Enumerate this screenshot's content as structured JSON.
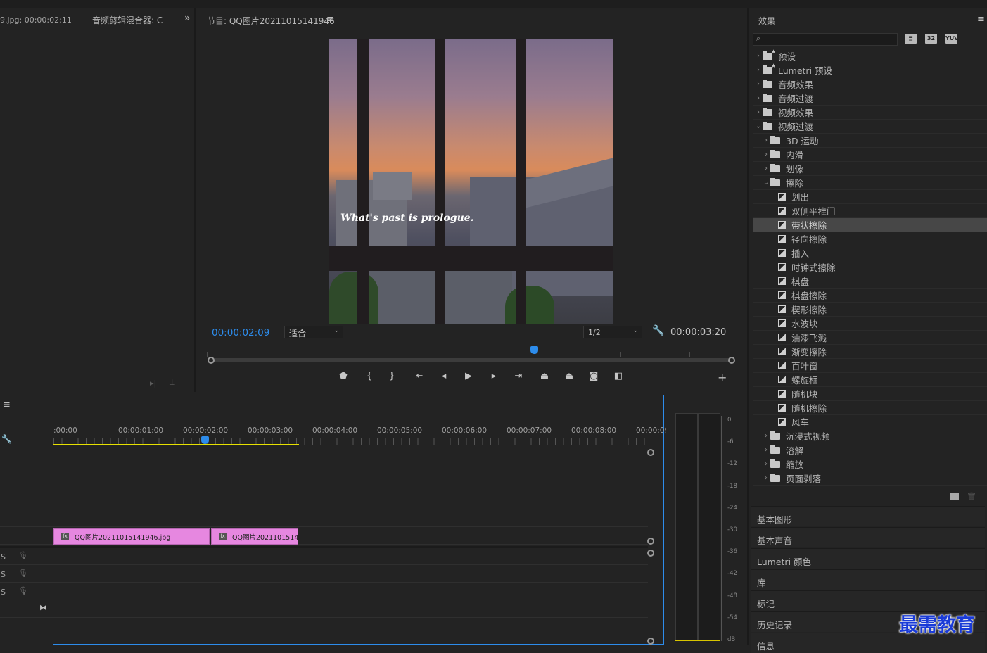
{
  "source_panel": {
    "tab_title": "9.jpg: 00:00:02:11",
    "mixer_tab": "音频剪辑混合器: C",
    "expand_icon": "double-chevron-right-icon"
  },
  "program": {
    "title": "节目: QQ图片20211015141946",
    "menu_icon": "hamburger-icon",
    "current_time": "00:00:02:09",
    "fit_label": "适合",
    "resolution_label": "1/2",
    "duration": "00:00:03:20",
    "image_text": "What's past is prologue.",
    "playhead_progress": 0.62,
    "accent": "#2d8ceb"
  },
  "controls": [
    {
      "name": "add-marker-button",
      "icon": "marker-icon",
      "glyph": "⬟"
    },
    {
      "name": "mark-in-button",
      "icon": "mark-in-icon",
      "glyph": "{"
    },
    {
      "name": "mark-out-button",
      "icon": "mark-out-icon",
      "glyph": "}"
    },
    {
      "name": "go-to-in-button",
      "icon": "go-to-in-icon",
      "glyph": "⇤"
    },
    {
      "name": "step-back-button",
      "icon": "step-back-icon",
      "glyph": "◂"
    },
    {
      "name": "play-button",
      "icon": "play-icon",
      "glyph": "▶"
    },
    {
      "name": "step-forward-button",
      "icon": "step-forward-icon",
      "glyph": "▸"
    },
    {
      "name": "go-to-out-button",
      "icon": "go-to-out-icon",
      "glyph": "⇥"
    },
    {
      "name": "lift-button",
      "icon": "lift-icon",
      "glyph": "⏏"
    },
    {
      "name": "extract-button",
      "icon": "extract-icon",
      "glyph": "⏏"
    },
    {
      "name": "export-frame-button",
      "icon": "camera-icon",
      "glyph": "◙"
    },
    {
      "name": "compare-view-button",
      "icon": "compare-icon",
      "glyph": "◧"
    }
  ],
  "effects": {
    "title": "效果",
    "menu_icon": "hamburger-icon",
    "search_placeholder": "",
    "toolbar_icons": [
      "accelerated-effects-icon",
      "32bit-icon",
      "yuv-icon"
    ],
    "toolbar_labels": [
      "≣",
      "32",
      "YUV"
    ],
    "tree": [
      {
        "label": "预设",
        "level": 0,
        "type": "folder-star",
        "open": false
      },
      {
        "label": "Lumetri 预设",
        "level": 0,
        "type": "folder-star",
        "open": false
      },
      {
        "label": "音频效果",
        "level": 0,
        "type": "folder",
        "open": false
      },
      {
        "label": "音频过渡",
        "level": 0,
        "type": "folder",
        "open": false
      },
      {
        "label": "视频效果",
        "level": 0,
        "type": "folder",
        "open": false
      },
      {
        "label": "视频过渡",
        "level": 0,
        "type": "folder",
        "open": true
      },
      {
        "label": "3D 运动",
        "level": 1,
        "type": "folder",
        "open": false
      },
      {
        "label": "内滑",
        "level": 1,
        "type": "folder",
        "open": false
      },
      {
        "label": "划像",
        "level": 1,
        "type": "folder",
        "open": false
      },
      {
        "label": "擦除",
        "level": 1,
        "type": "folder",
        "open": true
      },
      {
        "label": "划出",
        "level": 2,
        "type": "effect"
      },
      {
        "label": "双侧平推门",
        "level": 2,
        "type": "effect"
      },
      {
        "label": "带状擦除",
        "level": 2,
        "type": "effect",
        "selected": true
      },
      {
        "label": "径向擦除",
        "level": 2,
        "type": "effect"
      },
      {
        "label": "插入",
        "level": 2,
        "type": "effect"
      },
      {
        "label": "时钟式擦除",
        "level": 2,
        "type": "effect"
      },
      {
        "label": "棋盘",
        "level": 2,
        "type": "effect"
      },
      {
        "label": "棋盘擦除",
        "level": 2,
        "type": "effect"
      },
      {
        "label": "楔形擦除",
        "level": 2,
        "type": "effect"
      },
      {
        "label": "水波块",
        "level": 2,
        "type": "effect"
      },
      {
        "label": "油漆飞溅",
        "level": 2,
        "type": "effect"
      },
      {
        "label": "渐变擦除",
        "level": 2,
        "type": "effect"
      },
      {
        "label": "百叶窗",
        "level": 2,
        "type": "effect"
      },
      {
        "label": "螺旋框",
        "level": 2,
        "type": "effect"
      },
      {
        "label": "随机块",
        "level": 2,
        "type": "effect"
      },
      {
        "label": "随机擦除",
        "level": 2,
        "type": "effect"
      },
      {
        "label": "风车",
        "level": 2,
        "type": "effect"
      },
      {
        "label": "沉浸式视频",
        "level": 1,
        "type": "folder",
        "open": false
      },
      {
        "label": "溶解",
        "level": 1,
        "type": "folder",
        "open": false
      },
      {
        "label": "缩放",
        "level": 1,
        "type": "folder",
        "open": false
      },
      {
        "label": "页面剥落",
        "level": 1,
        "type": "folder",
        "open": false
      }
    ]
  },
  "side_sections": [
    "基本图形",
    "基本声音",
    "Lumetri 颜色",
    "库",
    "标记",
    "历史记录",
    "信息"
  ],
  "watermark": "最需教育",
  "timeline": {
    "ruler": [
      ":00:00",
      "00:00:01:00",
      "00:00:02:00",
      "00:00:03:00",
      "00:00:04:00",
      "00:00:05:00",
      "00:00:06:00",
      "00:00:07:00",
      "00:00:08:00",
      "00:00:09:"
    ],
    "clips": [
      {
        "label": "QQ图片20211015141946.jpg",
        "fx": "fx"
      },
      {
        "label": "QQ图片20211015141",
        "fx": "fx"
      }
    ],
    "audio_labels": [
      "S",
      "S",
      "S"
    ],
    "playhead_time_fraction": 0.255,
    "clip_color": "#e687e0",
    "workarea_color": "#e6e000"
  },
  "meter": {
    "labels": [
      "0",
      "-6",
      "-12",
      "-18",
      "-24",
      "-30",
      "-36",
      "-42",
      "-48",
      "-54",
      "dB"
    ]
  }
}
